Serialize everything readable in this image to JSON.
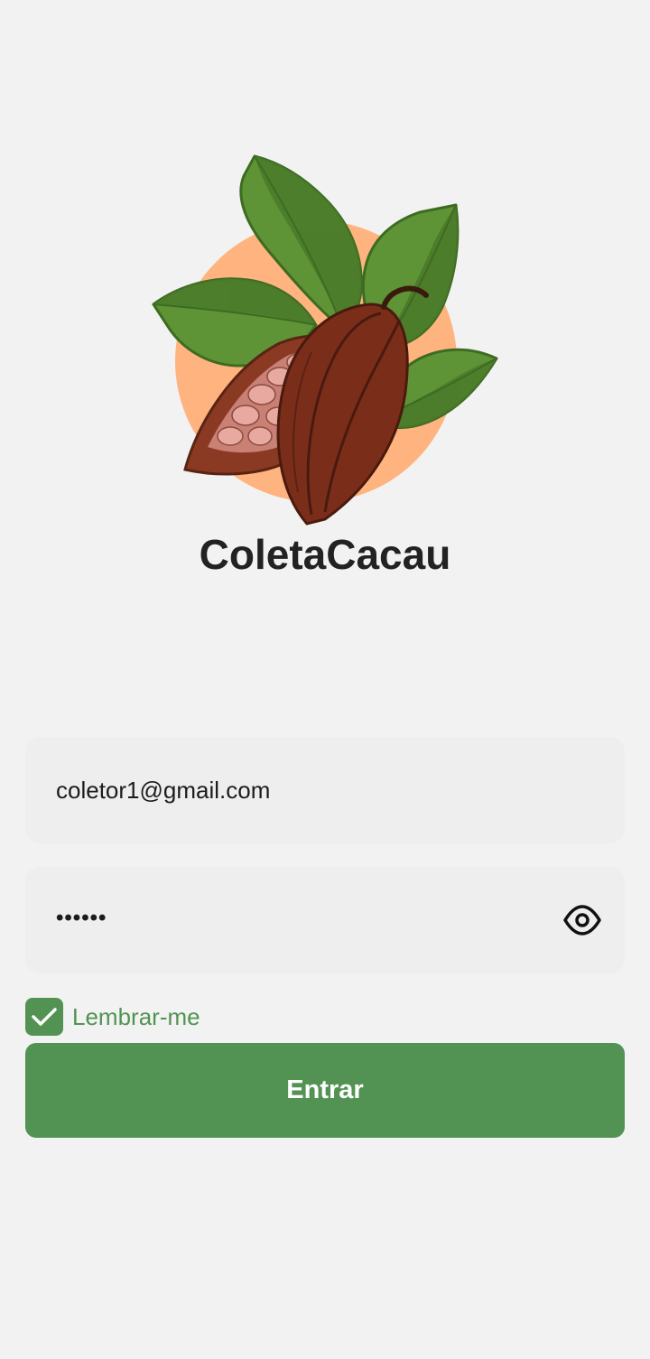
{
  "app": {
    "title": "ColetaCacau",
    "logo_icon": "cacao-pod-icon"
  },
  "login": {
    "email_value": "coletor1@gmail.com",
    "password_value": "••••••",
    "password_toggle_icon": "eye-icon",
    "remember_label": "Lembrar-me",
    "remember_checked": true,
    "submit_label": "Entrar"
  },
  "colors": {
    "background": "#f2f2f2",
    "field_background": "#eeeeee",
    "accent_green": "#529353",
    "title_text": "#222222",
    "logo_circle": "#ffb47f",
    "leaf_green": "#5a8f33",
    "pod_brown": "#7a2e1a"
  }
}
